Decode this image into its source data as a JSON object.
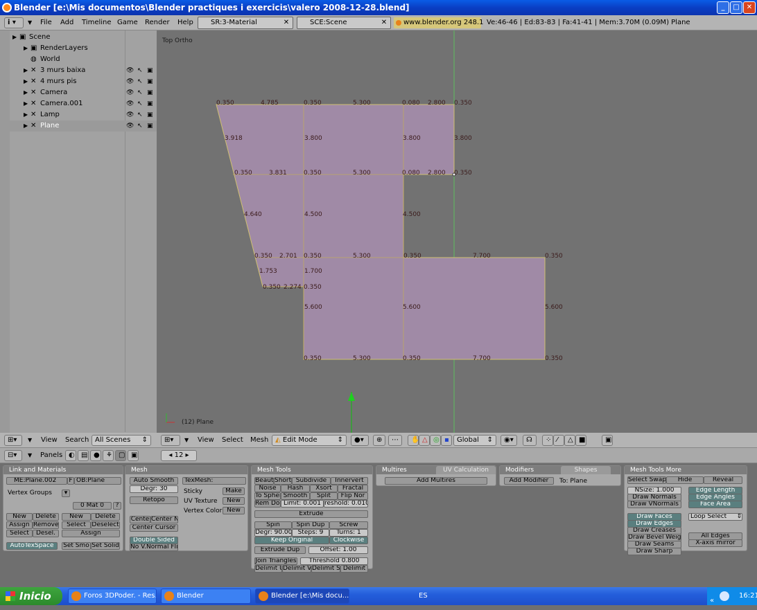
{
  "window": {
    "title": "Blender [e:\\Mis documentos\\Blender practiques i exercicis\\valero 2008-12-28.blend]"
  },
  "topbar": {
    "menus": [
      "File",
      "Add",
      "Timeline",
      "Game",
      "Render",
      "Help"
    ],
    "screen_field": "SR:3-Material",
    "scene_field": "SCE:Scene",
    "website": "www.blender.org 248.1",
    "stats": "Ve:46-46 | Ed:83-83 | Fa:41-41 | Mem:3.70M (0.09M) Plane"
  },
  "outliner": {
    "items": [
      {
        "label": "Scene",
        "indent": 0
      },
      {
        "label": "RenderLayers",
        "indent": 1
      },
      {
        "label": "World",
        "indent": 1
      },
      {
        "label": "3 murs baixa",
        "indent": 1
      },
      {
        "label": "4 murs pis",
        "indent": 1
      },
      {
        "label": "Camera",
        "indent": 1
      },
      {
        "label": "Camera.001",
        "indent": 1
      },
      {
        "label": "Lamp",
        "indent": 1
      },
      {
        "label": "Plane",
        "indent": 1
      }
    ],
    "footer": {
      "view": "View",
      "search": "Search",
      "scenes": "All Scenes"
    }
  },
  "viewport": {
    "label": "Top Ortho",
    "object_label": "(12) Plane",
    "dims": [
      "0.350",
      "4.785",
      "0.350",
      "5.300",
      "0.080",
      "2.800",
      "0.350",
      "3.918",
      "3.800",
      "3.800",
      "3.800",
      "0.350",
      "3.831",
      "0.350",
      "5.300",
      "0.080",
      "2.800",
      "0.350",
      "4.640",
      "4.500",
      "4.500",
      "0.350",
      "2.701",
      "0.350",
      "5.300",
      "0.350",
      "7.700",
      "0.350",
      "1.753",
      "1.700",
      "0.350",
      "2.274",
      "0.350",
      "5.600",
      "5.600",
      "5.600",
      "0.350",
      "5.300",
      "0.350",
      "7.700",
      "0.350"
    ],
    "footer": {
      "view": "View",
      "select": "Select",
      "mesh": "Mesh",
      "mode": "Edit Mode",
      "orientation": "Global"
    }
  },
  "buttons_header": {
    "panels": "Panels",
    "frame": "12"
  },
  "link_materials": {
    "title": "Link and Materials",
    "mesh": "ME:Plane.002",
    "f": "F",
    "ob": "OB:Plane",
    "vgroups": "Vertex Groups",
    "mat": "0 Mat 0",
    "q": "?",
    "new": "New",
    "delete": "Delete",
    "assign": "Assign",
    "remove": "Remove",
    "select": "Select",
    "desel": "Desel.",
    "new2": "New",
    "delete2": "Delete",
    "select2": "Select",
    "deselect2": "Deselect",
    "assign2": "Assign",
    "autotex": "AutoTexSpace",
    "setsmo": "Set Smo",
    "setsolid": "Set Solid"
  },
  "mesh_panel": {
    "title": "Mesh",
    "autosmooth": "Auto Smooth",
    "degr": "Degr: 30",
    "retopo": "Retopo",
    "centre": "Cente",
    "centern": "Center N",
    "centercursor": "Center Cursor",
    "doublesided": "Double Sided",
    "novnormal": "No V.Normal Fli",
    "texmesh": "TexMesh:",
    "sticky": "Sticky",
    "make": "Make",
    "uvtex": "UV Texture",
    "new1": "New",
    "vcol": "Vertex Color",
    "new2": "New"
  },
  "mesh_tools": {
    "title": "Mesh Tools",
    "row1": [
      "Beaut",
      "Short",
      "Subdivide",
      "Innervert"
    ],
    "row2": [
      "Noise",
      "Hash",
      "Xsort",
      "Fractal"
    ],
    "row3": [
      "To Spher",
      "Smooth",
      "Split",
      "Flip Nor"
    ],
    "row4": [
      "Rem Dou",
      "Limit: 0.001",
      "reshold: 0.010"
    ],
    "extrude": "Extrude",
    "row5": [
      "Spin",
      "Spin Dup",
      "Screw"
    ],
    "row6": [
      "Degr: 90.00",
      "Steps: 9",
      "Turns: 1"
    ],
    "keep": "Keep Original",
    "clockwise": "Clockwise",
    "extrudedup": "Extrude Dup",
    "offset": "Offset: 1.00",
    "jointri": "Join Triangles",
    "threshold": "Threshold 0.800",
    "row7": [
      "Delimit U",
      "Delimit V",
      "Delimit S",
      "Delimit"
    ]
  },
  "multires": {
    "tab1": "Multires",
    "tab2": "UV Calculation",
    "add": "Add Multires"
  },
  "modifiers": {
    "tab1": "Modifiers",
    "tab2": "Shapes",
    "add": "Add Modifier",
    "to": "To: Plane"
  },
  "mesh_tools_more": {
    "title": "Mesh Tools More",
    "row1": [
      "Select Swap",
      "Hide",
      "Reveal"
    ],
    "nsize": "NSize: 1.000",
    "drawnormals": "Draw Normals",
    "drawvnormals": "Draw VNormals",
    "edgelength": "Edge Length",
    "edgeangles": "Edge Angles",
    "facearea": "Face Area",
    "drawfaces": "Draw Faces",
    "drawedges": "Draw Edges",
    "drawcreases": "Draw Creases",
    "drawbevel": "Draw Bevel Weig",
    "drawseams": "Draw Seams",
    "drawsharp": "Draw Sharp",
    "loopselect": "Loop Select",
    "alledges": "All Edges",
    "xmirror": "X-axis mirror"
  },
  "taskbar": {
    "start": "Inicio",
    "tasks": [
      "Foros 3DPoder. - Res...",
      "Blender",
      "Blender [e:\\Mis docu..."
    ],
    "lang": "ES",
    "clock": "16:21"
  }
}
